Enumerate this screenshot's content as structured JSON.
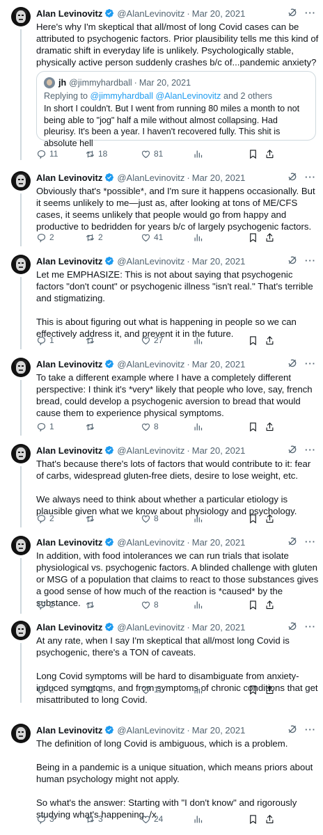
{
  "tweets": [
    {
      "name": "Alan Levinovitz",
      "handle": "@AlanLevinovitz",
      "date": "Mar 20, 2021",
      "text": "Here's why I'm skeptical that all/most of long Covid cases can be attributed to psychogenic factors. Prior plausibility tells me this kind of dramatic shift in everyday life is unlikely. Psychologically stable, physically active person suddenly crashes b/c of...pandemic anxiety?",
      "quote": {
        "name": "jh",
        "handle": "@jimmyhardball",
        "date": "Mar 20, 2021",
        "replying_prefix": "Replying to ",
        "replying_mentions": "@jimmyhardball @AlanLevinovitz",
        "replying_suffix": " and 2 others",
        "text": "In short I couldn't. But I went from running 80 miles a month to not being able to \"jog\" half a mile without almost collapsing. Had pleurisy. It's been a year. I haven't recovered fully. This shit is absolute hell"
      },
      "replies": "11",
      "retweets": "18",
      "likes": "81"
    },
    {
      "name": "Alan Levinovitz",
      "handle": "@AlanLevinovitz",
      "date": "Mar 20, 2021",
      "text": "Obviously that's *possible*, and I'm sure it happens occasionally. But it seems unlikely to me—just as, after looking at tons of ME/CFS cases, it seems unlikely that people would go from happy and productive to bedridden for years b/c of largely psychogenic factors.",
      "replies": "2",
      "retweets": "2",
      "likes": "41"
    },
    {
      "name": "Alan Levinovitz",
      "handle": "@AlanLevinovitz",
      "date": "Mar 20, 2021",
      "text": "Let me EMPHASIZE: This is not about saying that psychogenic factors \"don't count\" or psychogenic illness \"isn't real.\" That's terrible and stigmatizing.\n\nThis is about figuring out what is happening in people so we can effectively address it, and prevent it in the future.",
      "replies": "1",
      "retweets": "",
      "likes": "27"
    },
    {
      "name": "Alan Levinovitz",
      "handle": "@AlanLevinovitz",
      "date": "Mar 20, 2021",
      "text": "To take a different example where I have a completely different perspective: I think it's *very* likely that people who love, say, french bread, could develop a psychogenic aversion to bread that would cause them to experience physical symptoms.",
      "replies": "1",
      "retweets": "",
      "likes": "8"
    },
    {
      "name": "Alan Levinovitz",
      "handle": "@AlanLevinovitz",
      "date": "Mar 20, 2021",
      "text": "That's because there's lots of factors that would contribute to it: fear of carbs, widespread gluten-free diets, desire to lose weight, etc.\n\nWe always need to think about whether a particular etiology is plausible given what we know about physiology and psychology.",
      "replies": "2",
      "retweets": "",
      "likes": "8"
    },
    {
      "name": "Alan Levinovitz",
      "handle": "@AlanLevinovitz",
      "date": "Mar 20, 2021",
      "text": "In addition, with food intolerances we can run trials that isolate physiological vs. psychogenic factors. A blinded challenge with gluten or MSG of a population that claims to react to those substances gives a good sense of how much of the reaction is *caused* by the substance.",
      "replies": "2",
      "retweets": "",
      "likes": "8"
    },
    {
      "name": "Alan Levinovitz",
      "handle": "@AlanLevinovitz",
      "date": "Mar 20, 2021",
      "text": "At any rate, when I say I'm skeptical that all/most long Covid is psychogenic, there's a TON of caveats.\n\nLong Covid symptoms will be hard to disambiguate from anxiety-induced symptoms, and from symptoms of chronic conditions that get misattributed to long Covid.",
      "replies": "2",
      "retweets": "2",
      "likes": "11"
    },
    {
      "name": "Alan Levinovitz",
      "handle": "@AlanLevinovitz",
      "date": "Mar 20, 2021",
      "text": "The definition of long Covid is ambiguous, which is a problem.\n\nBeing in a pandemic is a unique situation, which means priors about human psychology might not apply.\n\nSo what's the answer: Starting with \"I don't know\" and rigorously studying what's happening. /x",
      "replies": "3",
      "retweets": "3",
      "likes": "24"
    }
  ],
  "icons": {
    "verified": "verified-badge-icon",
    "grok": "grok-icon",
    "more": "more-icon",
    "reply": "reply-icon",
    "retweet": "retweet-icon",
    "like": "heart-icon",
    "views": "views-icon",
    "bookmark": "bookmark-icon",
    "share": "share-icon"
  },
  "colors": {
    "accent": "#1d9bf0",
    "text": "#0f1419",
    "muted": "#536471",
    "border": "#cfd9de"
  },
  "more_glyph": "···"
}
